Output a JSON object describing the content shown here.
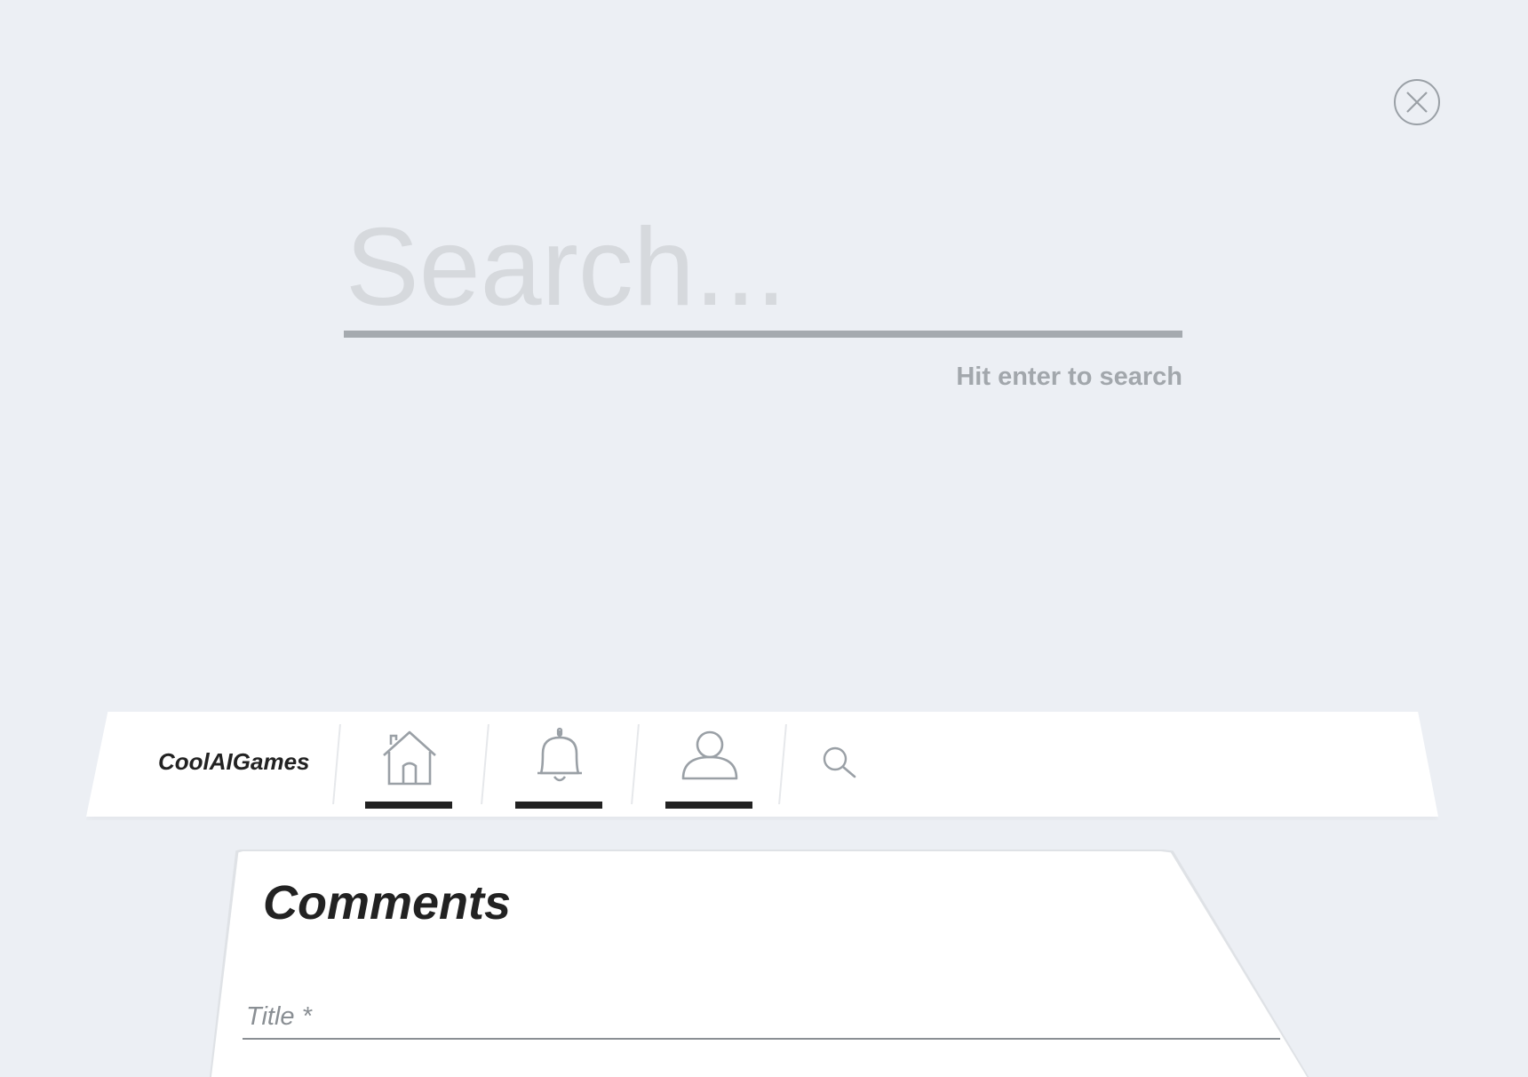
{
  "search_overlay": {
    "placeholder": "Search...",
    "value": "",
    "hint": "Hit enter to search",
    "close_icon": "close-circle-icon"
  },
  "navbar": {
    "brand": "CoolAIGames",
    "items": [
      {
        "icon": "home-icon",
        "active": true
      },
      {
        "icon": "bell-icon",
        "active": true
      },
      {
        "icon": "user-icon",
        "active": true
      }
    ],
    "search_icon": "search-icon"
  },
  "comments": {
    "heading": "Comments",
    "title_field_placeholder": "Title *",
    "title_field_value": ""
  },
  "colors": {
    "background": "#eceff4",
    "surface": "#ffffff",
    "text_dark": "#222222",
    "muted": "#a2a7ac",
    "placeholder": "#d6d9dd"
  }
}
